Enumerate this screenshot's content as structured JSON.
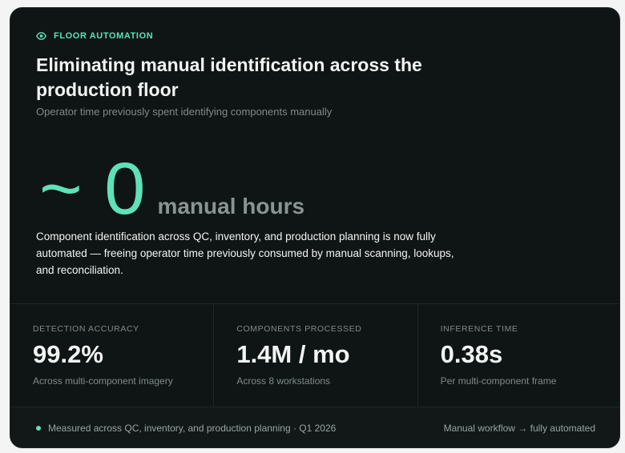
{
  "header": {
    "eyebrow_icon": "eye-icon",
    "eyebrow": "FLOOR AUTOMATION",
    "title": "Eliminating manual identification across the production floor",
    "subtitle": "Operator time previously spent identifying components manually"
  },
  "hero": {
    "value": "~ 0",
    "unit": "manual hours",
    "description": "Component identification across QC, inventory, and production planning is now fully automated — freeing operator time previously consumed by manual scanning, lookups, and reconciliation."
  },
  "stats": [
    {
      "label": "DETECTION ACCURACY",
      "value": "99.2%",
      "note": "Across multi-component imagery"
    },
    {
      "label": "COMPONENTS PROCESSED",
      "value": "1.4M / mo",
      "note": "Across 8 workstations"
    },
    {
      "label": "INFERENCE TIME",
      "value": "0.38s",
      "note": "Per multi-component frame"
    }
  ],
  "footer": {
    "left": "Measured across QC, inventory, and production planning · Q1 2026",
    "right": "Manual workflow → fully automated"
  },
  "colors": {
    "accent": "#5fe0b8",
    "background": "#0f1514",
    "text": "#f2f5f4",
    "muted": "#7f8a88"
  }
}
